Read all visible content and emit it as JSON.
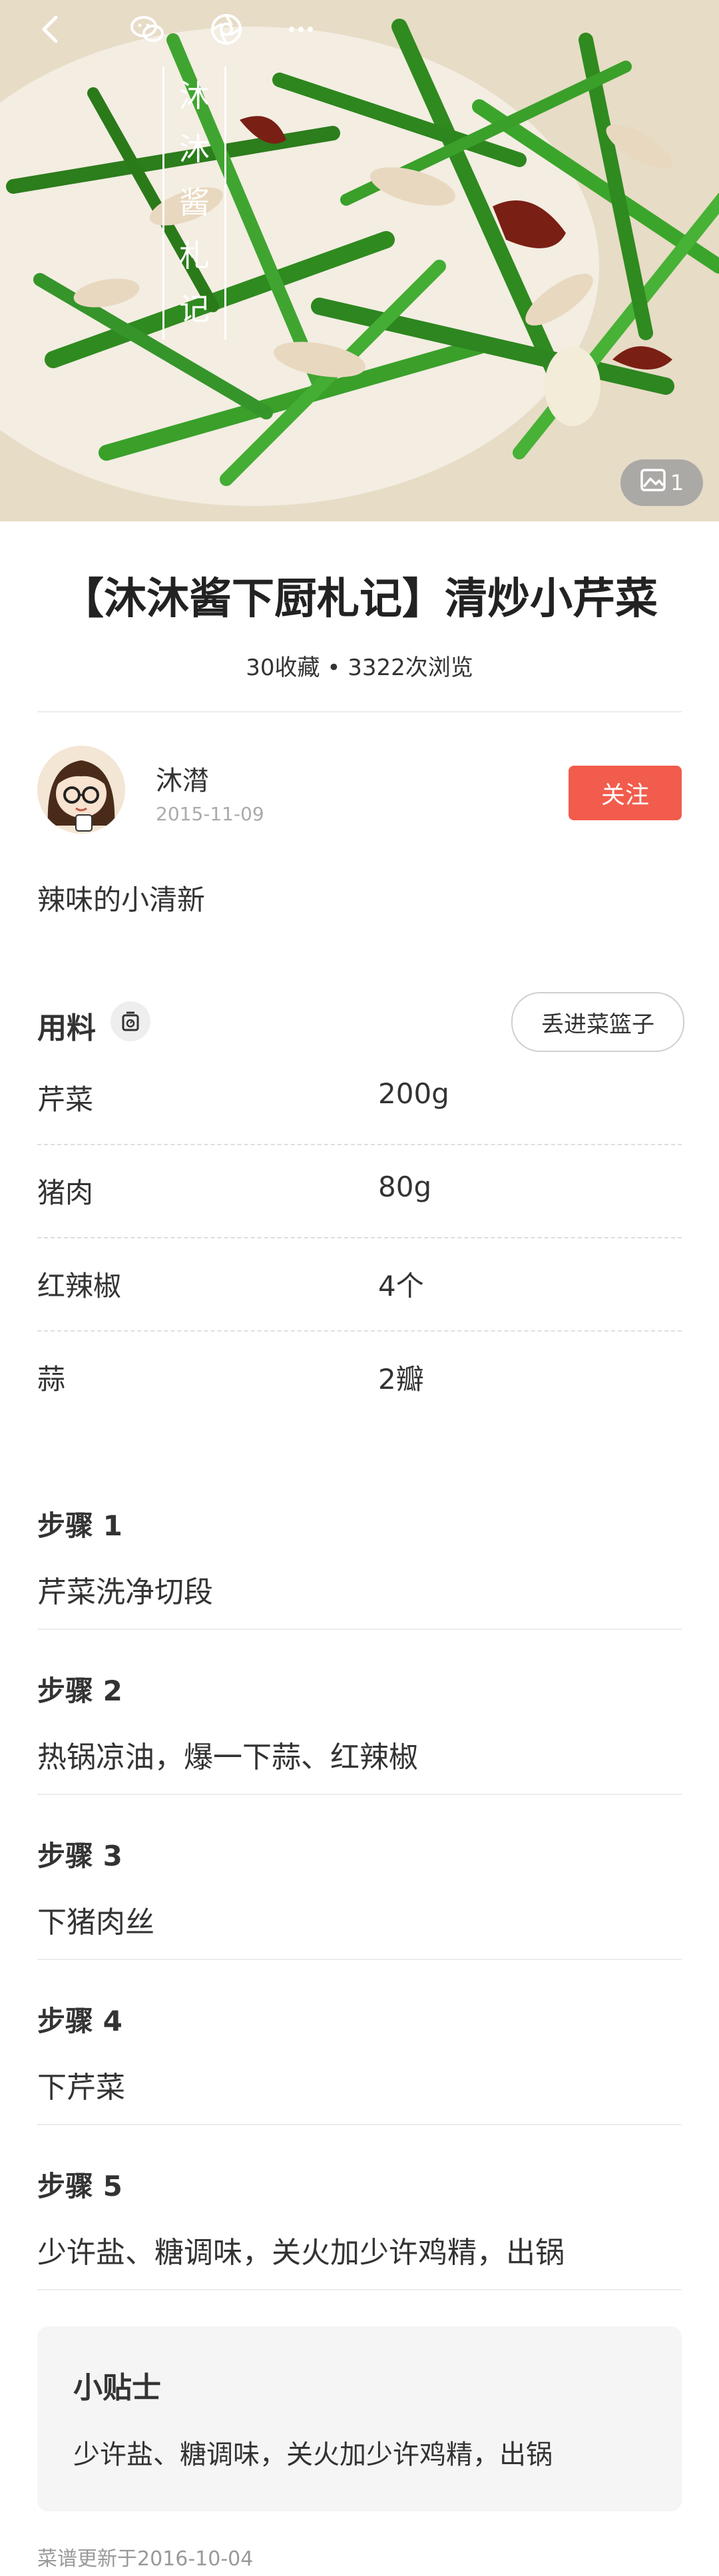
{
  "hero": {
    "brand_chars": [
      "沐",
      "沐",
      "酱",
      "札",
      "记"
    ],
    "photo_count": "1",
    "icons": [
      "back-icon",
      "wechat-icon",
      "moments-icon",
      "more-icon"
    ]
  },
  "recipe": {
    "title": "【沐沐酱下厨札记】清炒小芹菜",
    "stats": "30收藏 • 3322次浏览",
    "description": "辣味的小清新",
    "updated": "菜谱更新于2016-10-04"
  },
  "author": {
    "name": "沐潸",
    "date": "2015-11-09",
    "follow_label": "关注"
  },
  "ingredients": {
    "heading": "用料",
    "basket_label": "丢进菜篮子",
    "items": [
      {
        "name": "芹菜",
        "qty": "200g"
      },
      {
        "name": "猪肉",
        "qty": "80g"
      },
      {
        "name": "红辣椒",
        "qty": "4个"
      },
      {
        "name": "蒜",
        "qty": "2瓣"
      }
    ]
  },
  "steps": [
    {
      "label": "步骤 1",
      "text": "芹菜洗净切段"
    },
    {
      "label": "步骤 2",
      "text": "热锅凉油，爆一下蒜、红辣椒"
    },
    {
      "label": "步骤 3",
      "text": "下猪肉丝"
    },
    {
      "label": "步骤 4",
      "text": "下芹菜"
    },
    {
      "label": "步骤 5",
      "text": "少许盐、糖调味，关火加少许鸡精，出锅"
    }
  ],
  "tips": {
    "title": "小贴士",
    "text": "少许盐、糖调味，关火加少许鸡精，出锅"
  },
  "colors": {
    "accent": "#f25c4c",
    "text": "#333333",
    "muted": "#999999",
    "tips_bg": "#f5f5f5"
  }
}
